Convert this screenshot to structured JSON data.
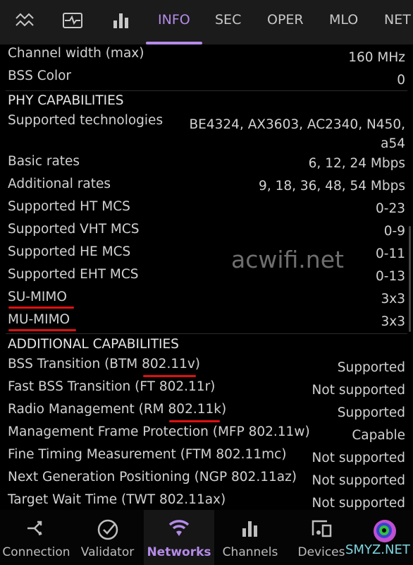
{
  "tabs": {
    "icons": [
      "signal-graph-icon",
      "monitor-pulse-icon",
      "bar-chart-icon"
    ],
    "items": [
      {
        "label": "INFO",
        "active": true
      },
      {
        "label": "SEC"
      },
      {
        "label": "OPER"
      },
      {
        "label": "MLO"
      },
      {
        "label": "NET"
      }
    ]
  },
  "rows_top": [
    {
      "label": "Channel width (max)",
      "value": "160 MHz"
    },
    {
      "label": "BSS Color",
      "value": "0"
    }
  ],
  "phy": {
    "title": "PHY CAPABILITIES",
    "tech_label": "Supported technologies",
    "tech_value_1": "BE4324, AX3603, AC2340, N450,",
    "tech_value_2": "a54",
    "rows": [
      {
        "label": "Basic rates",
        "value": "6, 12, 24 Mbps"
      },
      {
        "label": "Additional rates",
        "value": "9, 18, 36, 48, 54 Mbps"
      },
      {
        "label": "Supported HT MCS",
        "value": "0-23"
      },
      {
        "label": "Supported VHT MCS",
        "value": "0-9"
      },
      {
        "label": "Supported HE MCS",
        "value": "0-11"
      },
      {
        "label": "Supported EHT MCS",
        "value": "0-13"
      },
      {
        "label": "SU-MIMO",
        "value": "3x3"
      },
      {
        "label": "MU-MIMO",
        "value": "3x3"
      }
    ]
  },
  "additional": {
    "title": "ADDITIONAL CAPABILITIES",
    "rows": [
      {
        "label": "BSS Transition (BTM 802.11v)",
        "value": "Supported"
      },
      {
        "label": "Fast BSS Transition (FT 802.11r)",
        "value": "Not supported"
      },
      {
        "label": "Radio Management (RM 802.11k)",
        "value": "Supported"
      },
      {
        "label": "Management Frame Protection (MFP 802.11w)",
        "value": "Capable"
      },
      {
        "label": "Fine Timing Measurement (FTM 802.11mc)",
        "value": "Not supported"
      },
      {
        "label": "Next Generation Positioning (NGP 802.11az)",
        "value": "Not supported"
      },
      {
        "label": "Target Wait Time (TWT 802.11ax)",
        "value": "Not supported"
      }
    ]
  },
  "watermark": "acwifi.net",
  "watermark2": "SMYZ.NET",
  "nav": [
    {
      "label": "Connection",
      "icon": "connection-icon"
    },
    {
      "label": "Validator",
      "icon": "check-circle-icon"
    },
    {
      "label": "Networks",
      "icon": "wifi-icon",
      "active": true
    },
    {
      "label": "Channels",
      "icon": "bar-chart-icon"
    },
    {
      "label": "Devices",
      "icon": "devices-icon"
    }
  ],
  "colors": {
    "accent": "#b58be8",
    "underline": "#e01010"
  }
}
